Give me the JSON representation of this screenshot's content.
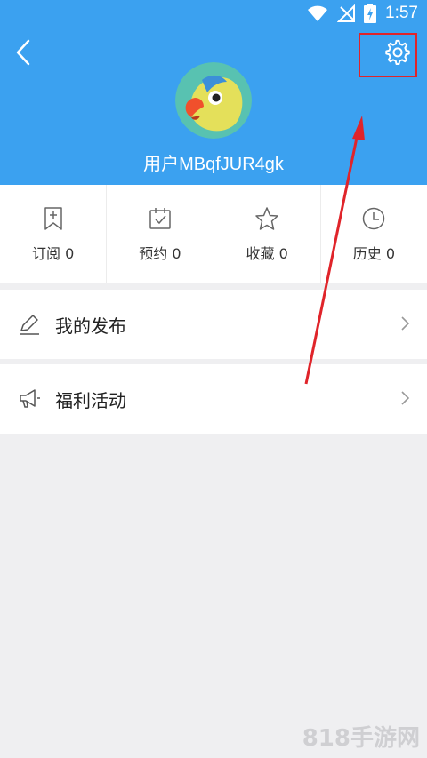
{
  "status_bar": {
    "time": "1:57"
  },
  "header": {
    "back_icon": "chevron-left-icon",
    "settings_icon": "gear-icon",
    "username": "用户MBqfJUR4gk",
    "bg_color": "#3ba1f0"
  },
  "stats": [
    {
      "label": "订阅 0",
      "icon": "bookmark-add-icon"
    },
    {
      "label": "预约 0",
      "icon": "calendar-check-icon"
    },
    {
      "label": "收藏 0",
      "icon": "star-icon"
    },
    {
      "label": "历史 0",
      "icon": "clock-icon"
    }
  ],
  "menu": [
    {
      "label": "我的发布",
      "icon": "pencil-icon"
    },
    {
      "label": "福利活动",
      "icon": "megaphone-icon"
    }
  ],
  "annotation_color": "#e0242a",
  "watermark": "818手游网"
}
